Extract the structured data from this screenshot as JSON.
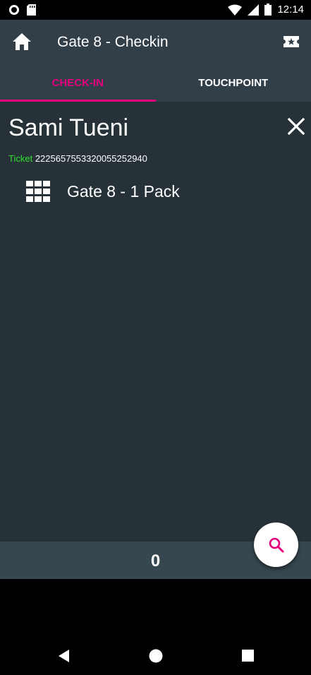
{
  "status_bar": {
    "time": "12:14",
    "icons": [
      "record-icon",
      "sd-card-icon",
      "wifi-icon",
      "signal-icon",
      "battery-icon"
    ]
  },
  "app_bar": {
    "title": "Gate 8 - Checkin",
    "left_icon": "home-icon",
    "right_icon": "ticket-star-icon"
  },
  "tabs": [
    {
      "label": "CHECK-IN",
      "active": true
    },
    {
      "label": "TOUCHPOINT",
      "active": false
    }
  ],
  "attendee": {
    "name": "Sami Tueni",
    "ticket_label": "Ticket",
    "ticket_number": "2225657553320055252940"
  },
  "packs": [
    {
      "icon": "grid-icon",
      "label": "Gate 8 - 1 Pack"
    }
  ],
  "footer": {
    "count": "0"
  },
  "fab": {
    "icon": "search-icon"
  },
  "colors": {
    "accent": "#e4007c",
    "ticket_label": "#2ee02e",
    "app_bar": "#323f49",
    "content_bg": "#263238",
    "footer_bg": "#37474f"
  }
}
